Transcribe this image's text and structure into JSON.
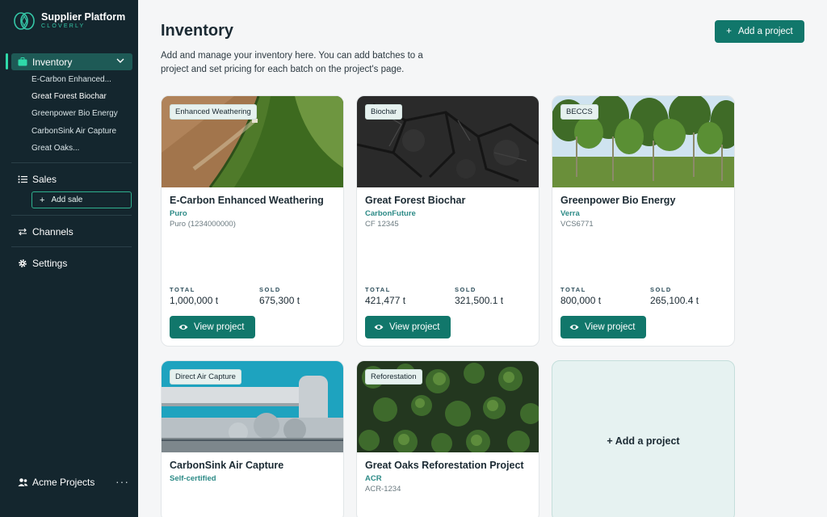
{
  "brand": {
    "title": "Supplier Platform",
    "subtitle": "CLOVERLY"
  },
  "sidebar": {
    "inventory_label": "Inventory",
    "inventory_items": [
      "E-Carbon Enhanced...",
      "Great Forest Biochar",
      "Greenpower Bio Energy",
      "CarbonSink Air Capture",
      "Great Oaks..."
    ],
    "sales_label": "Sales",
    "add_sale_label": "Add sale",
    "channels_label": "Channels",
    "settings_label": "Settings",
    "account_label": "Acme Projects",
    "more_label": "···"
  },
  "main": {
    "title": "Inventory",
    "description": "Add and manage your inventory here. You can add batches to a project and set pricing for each batch on the project's page.",
    "add_project_label": "Add a project",
    "add_project_card_label": "+ Add a project"
  },
  "labels": {
    "total": "TOTAL",
    "sold": "SOLD",
    "view_project": "View project"
  },
  "projects": [
    {
      "tag": "Enhanced Weathering",
      "title": "E-Carbon Enhanced Weathering",
      "registry": "Puro",
      "registry_id": "Puro (1234000000)",
      "total": "1,000,000 t",
      "sold": "675,300 t"
    },
    {
      "tag": "Biochar",
      "title": "Great Forest Biochar",
      "registry": "CarbonFuture",
      "registry_id": "CF 12345",
      "total": "421,477 t",
      "sold": "321,500.1 t"
    },
    {
      "tag": "BECCS",
      "title": "Greenpower Bio Energy",
      "registry": "Verra",
      "registry_id": "VCS6771",
      "total": "800,000 t",
      "sold": "265,100.4 t"
    },
    {
      "tag": "Direct Air Capture",
      "title": "CarbonSink Air Capture",
      "registry": "Self-certified",
      "registry_id": ""
    },
    {
      "tag": "Reforestation",
      "title": "Great Oaks Reforestation Project",
      "registry": "ACR",
      "registry_id": "ACR-1234"
    }
  ],
  "colors": {
    "sidebar_bg": "#14262e",
    "accent": "#11776b",
    "active_nav": "#1e5a56",
    "highlight": "#2fd9a9"
  }
}
